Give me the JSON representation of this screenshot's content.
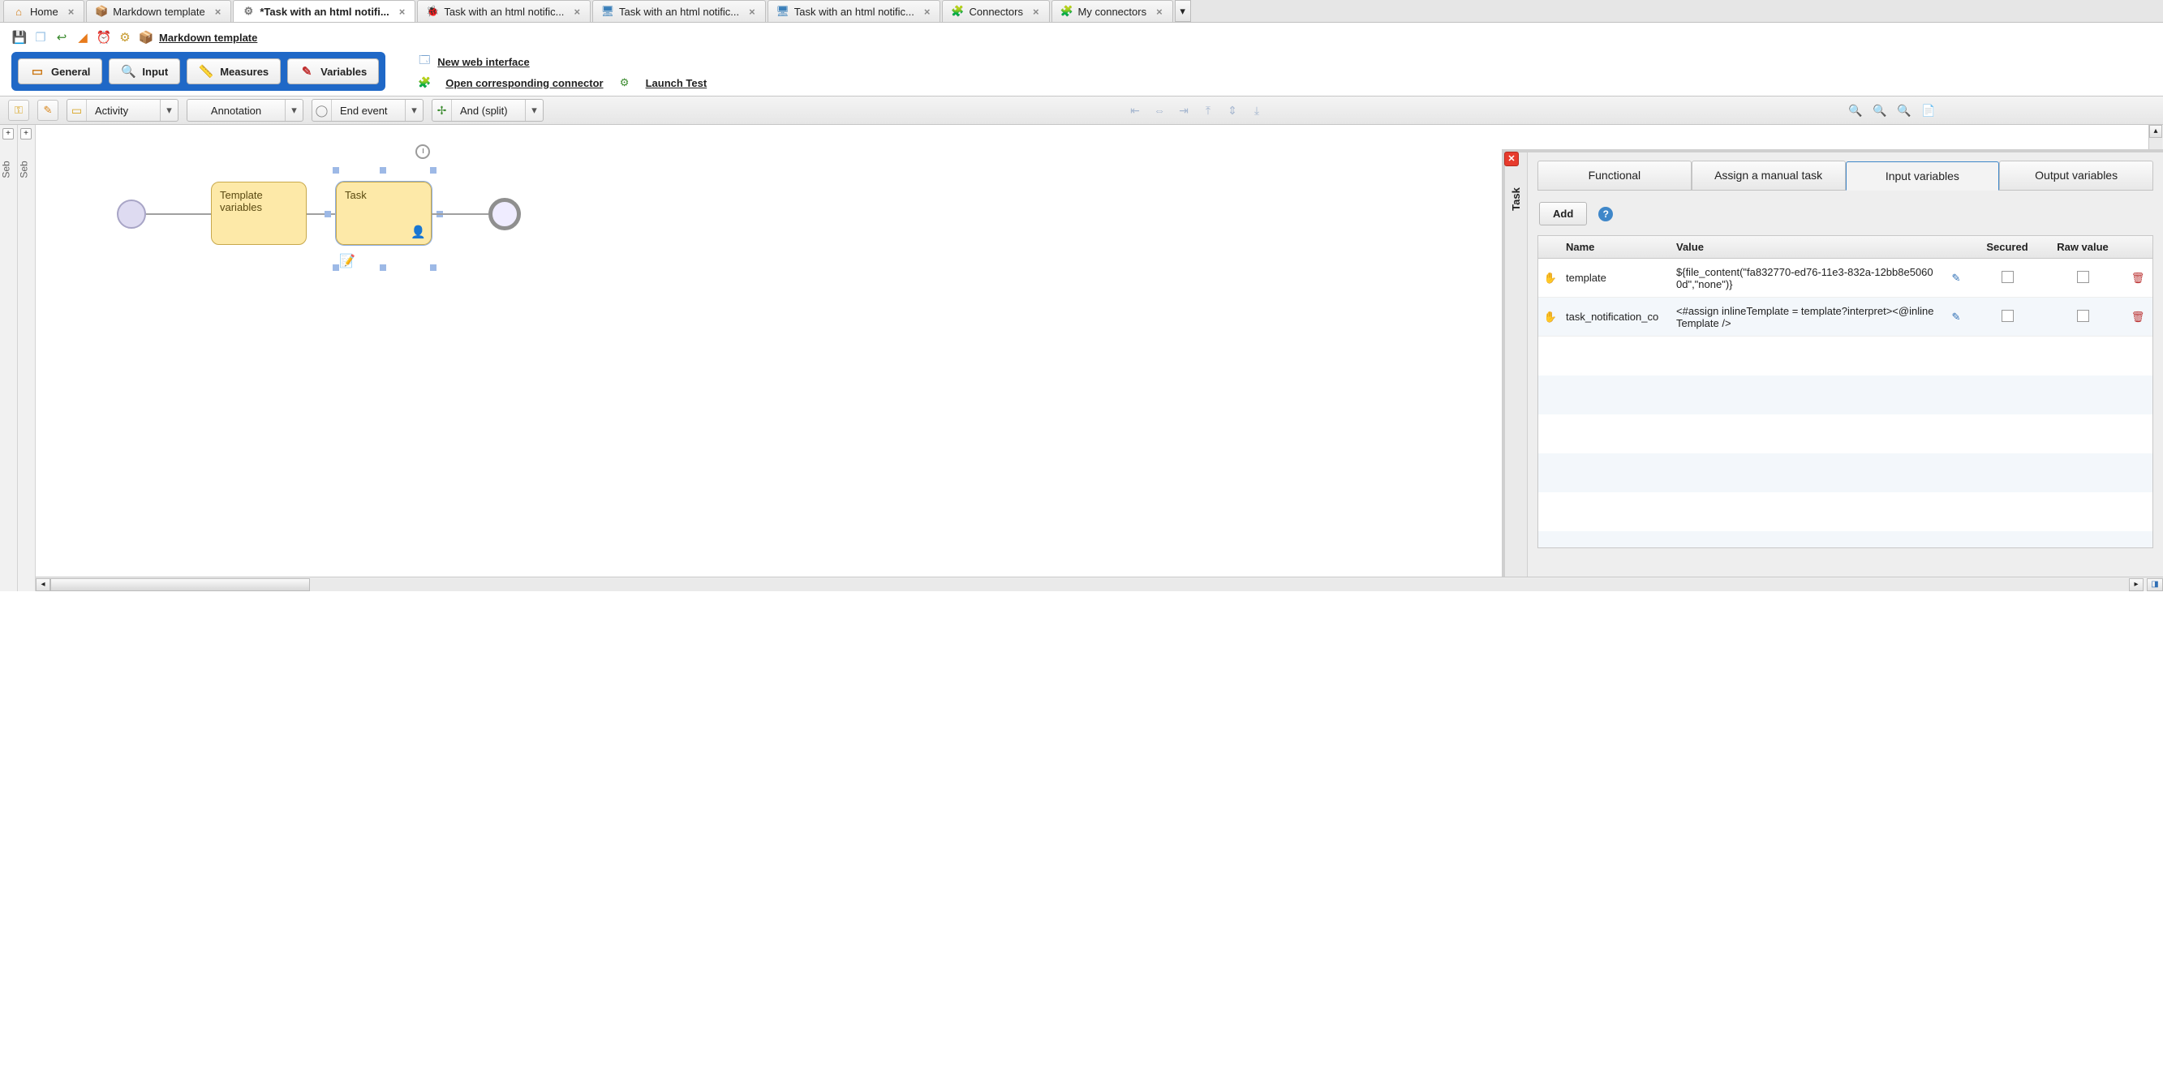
{
  "tabs": [
    {
      "icon": "home",
      "label": "Home",
      "closable": true,
      "class": "i-home",
      "glyph": "⌂"
    },
    {
      "icon": "box",
      "label": "Markdown template",
      "closable": true,
      "class": "i-box",
      "glyph": "📦"
    },
    {
      "icon": "gear",
      "label": "*Task with an html notifi...",
      "closable": true,
      "active": true,
      "class": "i-gear",
      "glyph": "⚙"
    },
    {
      "icon": "bug",
      "label": "Task with an html notific...",
      "closable": true,
      "class": "i-bug",
      "glyph": "🐞"
    },
    {
      "icon": "screen",
      "label": "Task with an html notific...",
      "closable": true,
      "class": "i-screen",
      "glyph": "🖥"
    },
    {
      "icon": "screen",
      "label": "Task with an html notific...",
      "closable": true,
      "class": "i-screen",
      "glyph": "🖥"
    },
    {
      "icon": "plug",
      "label": "Connectors",
      "closable": true,
      "class": "i-plug",
      "glyph": "🧩"
    },
    {
      "icon": "plug",
      "label": "My connectors",
      "closable": true,
      "class": "i-plug",
      "glyph": "🧩"
    }
  ],
  "breadcrumb": "Markdown template",
  "modeButtons": {
    "general": "General",
    "input": "Input",
    "measures": "Measures",
    "variables": "Variables"
  },
  "links": {
    "newWeb": "New web interface",
    "openConn": "Open corresponding connector",
    "launchTest": "Launch Test"
  },
  "combos": {
    "activity": "Activity",
    "annotation": "Annotation",
    "endEvent": "End event",
    "andSplit": "And (split)"
  },
  "gutterLabel": "Seb",
  "diagram": {
    "node1": "Template variables",
    "node2": "Task"
  },
  "taskPanel": {
    "title": "Task",
    "tabs": {
      "functional": "Functional",
      "manual": "Assign a manual task",
      "input": "Input variables",
      "output": "Output variables"
    },
    "add": "Add",
    "headers": {
      "name": "Name",
      "value": "Value",
      "secured": "Secured",
      "raw": "Raw value"
    },
    "rows": [
      {
        "name": "template",
        "value": "${file_content(\"fa832770-ed76-11e3-832a-12bb8e50600d\",\"none\")}"
      },
      {
        "name": "task_notification_co",
        "value": "<#assign inlineTemplate = template?interpret><@inlineTemplate />"
      }
    ]
  }
}
